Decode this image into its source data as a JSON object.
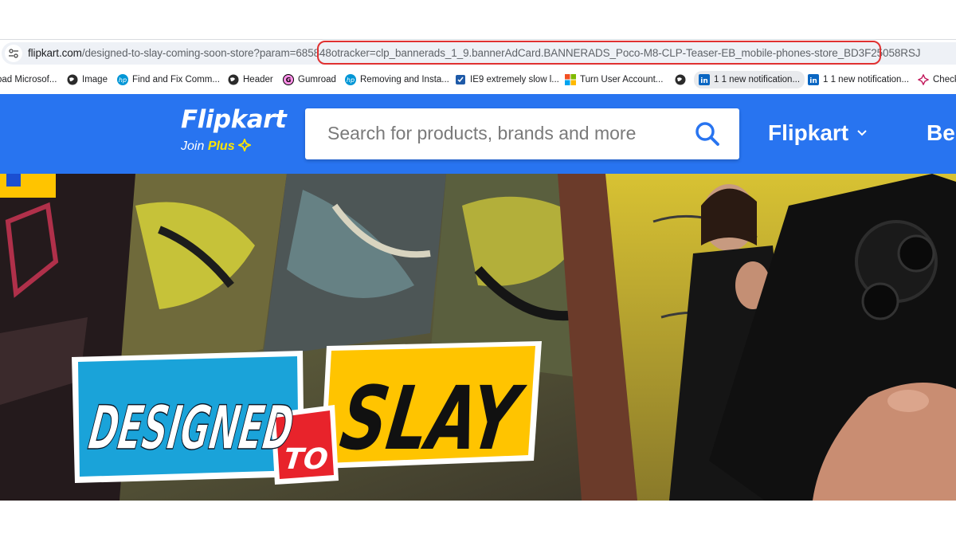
{
  "browser": {
    "url_host": "flipkart.com",
    "url_path": "/designed-to-slay-coming-soon-store?param=685848",
    "url_tracker": "otracker=clp_bannerads_1_9.bannerAdCard.BANNERADS_Poco-M8-CLP-Teaser-EB_mobile-phones-store_BD3F25058RSJ",
    "bookmarks": [
      {
        "label": "oad Microsof...",
        "icon": "download-icon"
      },
      {
        "label": "Image",
        "icon": "globe-icon"
      },
      {
        "label": "Find and Fix Comm...",
        "icon": "hp-icon"
      },
      {
        "label": "Header",
        "icon": "globe-icon"
      },
      {
        "label": "Gumroad",
        "icon": "gumroad-icon"
      },
      {
        "label": "Removing and Insta...",
        "icon": "hp-icon"
      },
      {
        "label": "IE9 extremely slow l...",
        "icon": "app-icon"
      },
      {
        "label": "Turn User Account...",
        "icon": "windows-icon"
      },
      {
        "label": "",
        "icon": "globe-icon"
      },
      {
        "label": "1 1 new notification...",
        "icon": "linkedin-icon"
      },
      {
        "label": "1 1 new notification...",
        "icon": "linkedin-icon"
      },
      {
        "label": "Check",
        "icon": "flower-icon"
      }
    ]
  },
  "header": {
    "logo": "Flipkart",
    "join_text": "Join",
    "plus_text": "Plus",
    "search_placeholder": "Search for products, brands and more",
    "account_label": "Flipkart",
    "become_label": "Be"
  },
  "banner": {
    "line1": "DESIGNED",
    "line2": "TO",
    "line3": "SLAY"
  },
  "colors": {
    "brand_blue": "#2874f0",
    "plus_yellow": "#ffe500",
    "highlight_red": "#e03131",
    "slay_cyan": "#1aa3d9",
    "slay_yellow": "#ffc400",
    "slay_red": "#e8232b"
  }
}
